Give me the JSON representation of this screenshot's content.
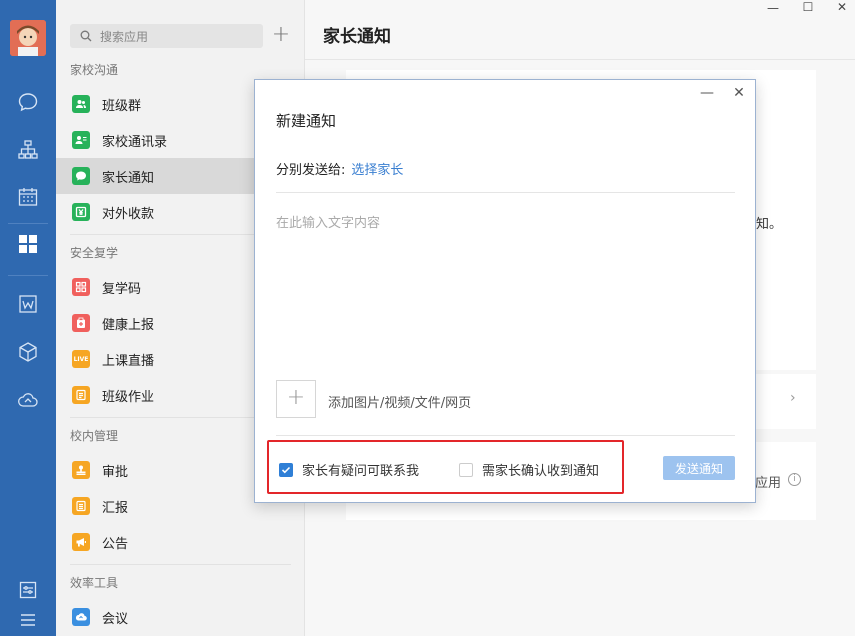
{
  "window": {
    "minimize": "—",
    "maximize": "☐",
    "close": "✕"
  },
  "sidebar": {
    "search_placeholder": "搜索应用",
    "add_icon": "+",
    "sections": [
      {
        "title": "家校沟通",
        "items": [
          {
            "label": "班级群",
            "icon": "group-icon",
            "color": "#27b25a"
          },
          {
            "label": "家校通讯录",
            "icon": "contacts-icon",
            "color": "#27b25a"
          },
          {
            "label": "家长通知",
            "icon": "chat-bubble-icon",
            "color": "#27b25a"
          },
          {
            "label": "对外收款",
            "icon": "yuan-icon",
            "color": "#27b25a"
          }
        ]
      },
      {
        "title": "安全复学",
        "items": [
          {
            "label": "复学码",
            "icon": "qr-icon",
            "color": "#f0605d"
          },
          {
            "label": "健康上报",
            "icon": "report-icon",
            "color": "#f0605d"
          },
          {
            "label": "上课直播",
            "icon": "live-icon",
            "color": "#f6a623"
          },
          {
            "label": "班级作业",
            "icon": "homework-icon",
            "color": "#f6a623"
          }
        ]
      },
      {
        "title": "校内管理",
        "items": [
          {
            "label": "审批",
            "icon": "approve-icon",
            "color": "#f6a623"
          },
          {
            "label": "汇报",
            "icon": "doc-icon",
            "color": "#f6a623"
          },
          {
            "label": "公告",
            "icon": "megaphone-icon",
            "color": "#f6a623"
          }
        ]
      },
      {
        "title": "效率工具",
        "items": [
          {
            "label": "会议",
            "icon": "meeting-icon",
            "color": "#3a8fe0"
          }
        ]
      }
    ],
    "live_badge": "LIVE"
  },
  "main": {
    "title": "家长通知",
    "bg_text_1": "知。",
    "bg_text_2": "应用"
  },
  "dialog": {
    "title": "新建通知",
    "send_to_label": "分别发送给:",
    "send_to_link": "选择家长",
    "text_placeholder": "在此输入文字内容",
    "add_label": "添加图片/视频/文件/网页",
    "add_icon": "+",
    "checkbox1": {
      "label": "家长有疑问可联系我",
      "checked": true
    },
    "checkbox2": {
      "label": "需家长确认收到通知",
      "checked": false
    },
    "send_button": "发送通知",
    "minimize": "—",
    "close": "✕"
  },
  "colors": {
    "accent": "#2f69b0",
    "link": "#3a7fd1",
    "highlight_box": "#e3262a",
    "send_disabled": "#9dc3ef"
  }
}
